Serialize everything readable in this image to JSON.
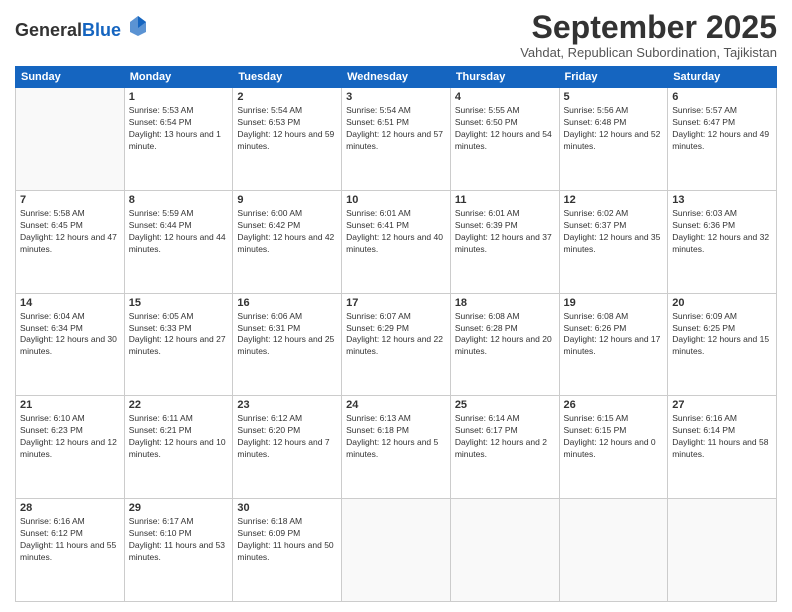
{
  "logo": {
    "general": "General",
    "blue": "Blue"
  },
  "title": "September 2025",
  "subtitle": "Vahdat, Republican Subordination, Tajikistan",
  "days_header": [
    "Sunday",
    "Monday",
    "Tuesday",
    "Wednesday",
    "Thursday",
    "Friday",
    "Saturday"
  ],
  "weeks": [
    [
      {
        "day": "",
        "empty": true
      },
      {
        "day": "1",
        "sunrise": "5:53 AM",
        "sunset": "6:54 PM",
        "daylight": "13 hours and 1 minute."
      },
      {
        "day": "2",
        "sunrise": "5:54 AM",
        "sunset": "6:53 PM",
        "daylight": "12 hours and 59 minutes."
      },
      {
        "day": "3",
        "sunrise": "5:54 AM",
        "sunset": "6:51 PM",
        "daylight": "12 hours and 57 minutes."
      },
      {
        "day": "4",
        "sunrise": "5:55 AM",
        "sunset": "6:50 PM",
        "daylight": "12 hours and 54 minutes."
      },
      {
        "day": "5",
        "sunrise": "5:56 AM",
        "sunset": "6:48 PM",
        "daylight": "12 hours and 52 minutes."
      },
      {
        "day": "6",
        "sunrise": "5:57 AM",
        "sunset": "6:47 PM",
        "daylight": "12 hours and 49 minutes."
      }
    ],
    [
      {
        "day": "7",
        "sunrise": "5:58 AM",
        "sunset": "6:45 PM",
        "daylight": "12 hours and 47 minutes."
      },
      {
        "day": "8",
        "sunrise": "5:59 AM",
        "sunset": "6:44 PM",
        "daylight": "12 hours and 44 minutes."
      },
      {
        "day": "9",
        "sunrise": "6:00 AM",
        "sunset": "6:42 PM",
        "daylight": "12 hours and 42 minutes."
      },
      {
        "day": "10",
        "sunrise": "6:01 AM",
        "sunset": "6:41 PM",
        "daylight": "12 hours and 40 minutes."
      },
      {
        "day": "11",
        "sunrise": "6:01 AM",
        "sunset": "6:39 PM",
        "daylight": "12 hours and 37 minutes."
      },
      {
        "day": "12",
        "sunrise": "6:02 AM",
        "sunset": "6:37 PM",
        "daylight": "12 hours and 35 minutes."
      },
      {
        "day": "13",
        "sunrise": "6:03 AM",
        "sunset": "6:36 PM",
        "daylight": "12 hours and 32 minutes."
      }
    ],
    [
      {
        "day": "14",
        "sunrise": "6:04 AM",
        "sunset": "6:34 PM",
        "daylight": "12 hours and 30 minutes."
      },
      {
        "day": "15",
        "sunrise": "6:05 AM",
        "sunset": "6:33 PM",
        "daylight": "12 hours and 27 minutes."
      },
      {
        "day": "16",
        "sunrise": "6:06 AM",
        "sunset": "6:31 PM",
        "daylight": "12 hours and 25 minutes."
      },
      {
        "day": "17",
        "sunrise": "6:07 AM",
        "sunset": "6:29 PM",
        "daylight": "12 hours and 22 minutes."
      },
      {
        "day": "18",
        "sunrise": "6:08 AM",
        "sunset": "6:28 PM",
        "daylight": "12 hours and 20 minutes."
      },
      {
        "day": "19",
        "sunrise": "6:08 AM",
        "sunset": "6:26 PM",
        "daylight": "12 hours and 17 minutes."
      },
      {
        "day": "20",
        "sunrise": "6:09 AM",
        "sunset": "6:25 PM",
        "daylight": "12 hours and 15 minutes."
      }
    ],
    [
      {
        "day": "21",
        "sunrise": "6:10 AM",
        "sunset": "6:23 PM",
        "daylight": "12 hours and 12 minutes."
      },
      {
        "day": "22",
        "sunrise": "6:11 AM",
        "sunset": "6:21 PM",
        "daylight": "12 hours and 10 minutes."
      },
      {
        "day": "23",
        "sunrise": "6:12 AM",
        "sunset": "6:20 PM",
        "daylight": "12 hours and 7 minutes."
      },
      {
        "day": "24",
        "sunrise": "6:13 AM",
        "sunset": "6:18 PM",
        "daylight": "12 hours and 5 minutes."
      },
      {
        "day": "25",
        "sunrise": "6:14 AM",
        "sunset": "6:17 PM",
        "daylight": "12 hours and 2 minutes."
      },
      {
        "day": "26",
        "sunrise": "6:15 AM",
        "sunset": "6:15 PM",
        "daylight": "12 hours and 0 minutes."
      },
      {
        "day": "27",
        "sunrise": "6:16 AM",
        "sunset": "6:14 PM",
        "daylight": "11 hours and 58 minutes."
      }
    ],
    [
      {
        "day": "28",
        "sunrise": "6:16 AM",
        "sunset": "6:12 PM",
        "daylight": "11 hours and 55 minutes."
      },
      {
        "day": "29",
        "sunrise": "6:17 AM",
        "sunset": "6:10 PM",
        "daylight": "11 hours and 53 minutes."
      },
      {
        "day": "30",
        "sunrise": "6:18 AM",
        "sunset": "6:09 PM",
        "daylight": "11 hours and 50 minutes."
      },
      {
        "day": "",
        "empty": true
      },
      {
        "day": "",
        "empty": true
      },
      {
        "day": "",
        "empty": true
      },
      {
        "day": "",
        "empty": true
      }
    ]
  ],
  "labels": {
    "sunrise_prefix": "Sunrise: ",
    "sunset_prefix": "Sunset: ",
    "daylight_prefix": "Daylight: "
  }
}
